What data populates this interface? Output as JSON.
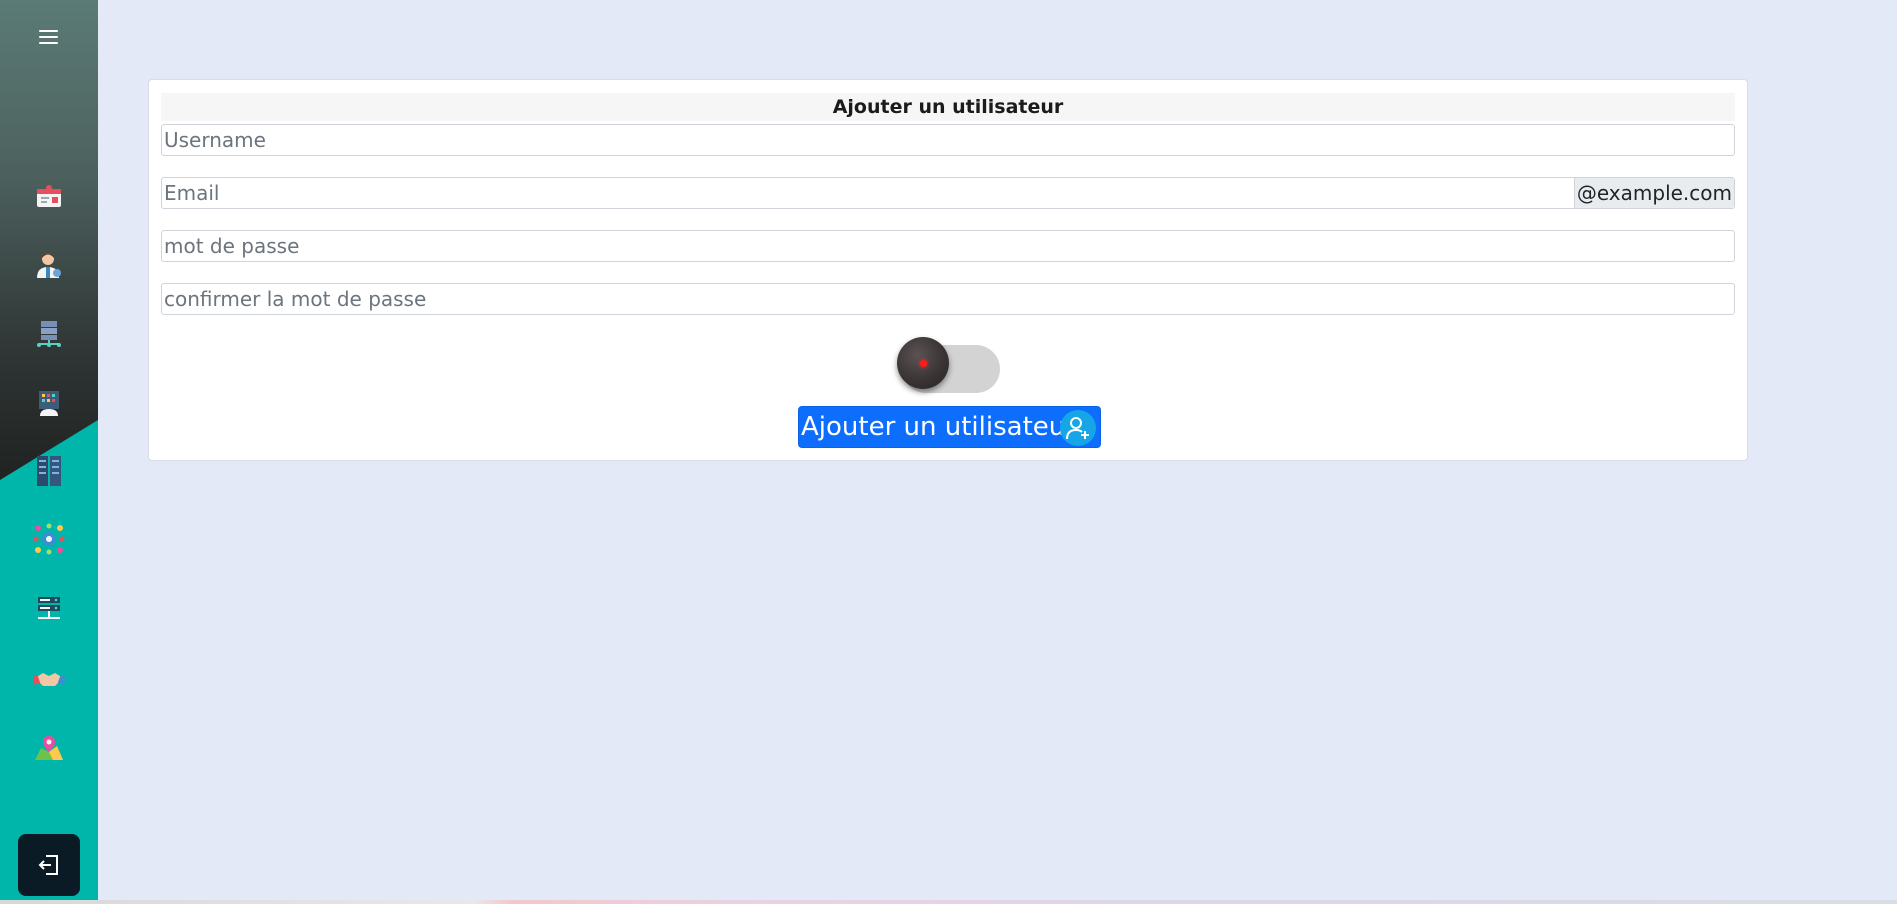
{
  "sidebar": {
    "items": [
      {
        "icon": "medical-record-icon"
      },
      {
        "icon": "doctor-icon"
      },
      {
        "icon": "server-network-icon"
      },
      {
        "icon": "building-icon"
      },
      {
        "icon": "server-rack-icon"
      },
      {
        "icon": "network-icon"
      },
      {
        "icon": "server-list-icon"
      },
      {
        "icon": "handshake-icon"
      },
      {
        "icon": "map-location-icon"
      }
    ]
  },
  "form": {
    "title": "Ajouter un utilisateur",
    "username_placeholder": "Username",
    "email_placeholder": "Email",
    "email_suffix": "@example.com",
    "password_placeholder": "mot de passe",
    "confirm_password_placeholder": "confirmer la mot de passe",
    "submit_label": "Ajouter un utilisateur"
  },
  "colors": {
    "accent": "#0d6efd",
    "sidebar_teal": "#00b6aa",
    "background": "#e3e9f6"
  }
}
